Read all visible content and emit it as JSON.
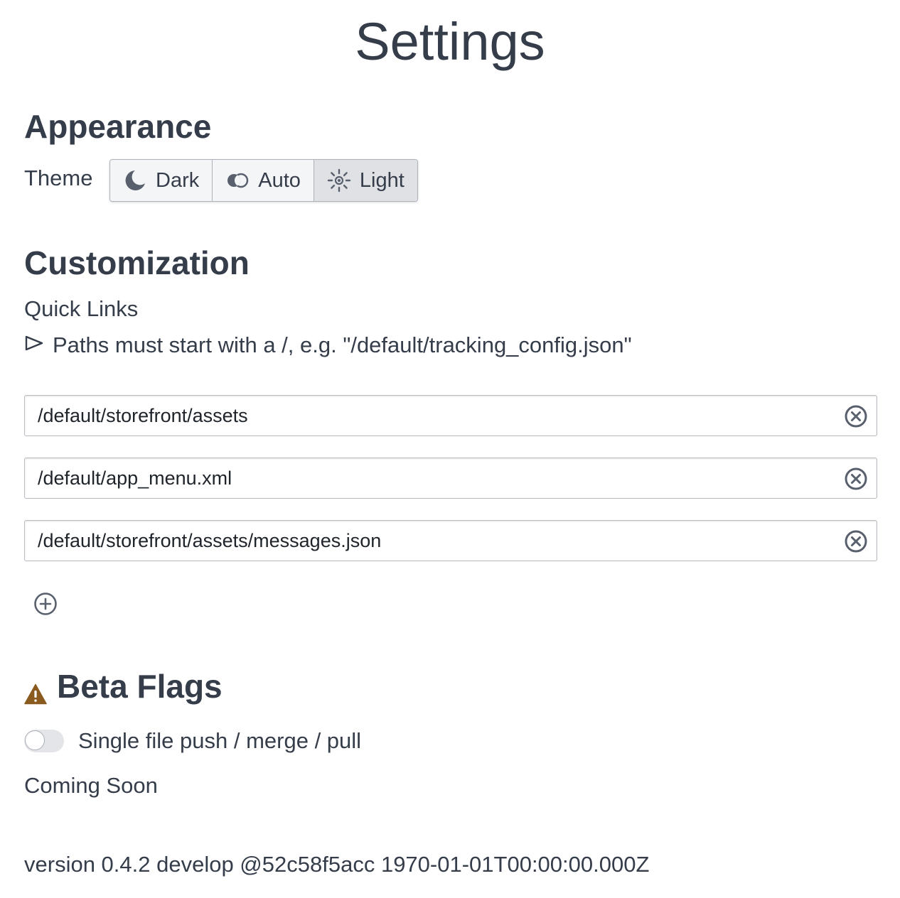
{
  "page": {
    "title": "Settings"
  },
  "appearance": {
    "heading": "Appearance",
    "theme_label": "Theme",
    "theme_options": [
      {
        "label": "Dark",
        "icon": "moon-icon"
      },
      {
        "label": "Auto",
        "icon": "auto-theme-icon"
      },
      {
        "label": "Light",
        "icon": "sun-icon"
      }
    ],
    "selected_theme": "Light"
  },
  "customization": {
    "heading": "Customization",
    "quick_links_label": "Quick Links",
    "hint_icon": "triangle-right-icon",
    "hint": "Paths must start with a /, e.g. \"/default/tracking_config.json\"",
    "links": [
      "/default/storefront/assets",
      "/default/app_menu.xml",
      "/default/storefront/assets/messages.json"
    ],
    "clear_icon": "circle-x-icon",
    "add_icon": "circle-plus-icon"
  },
  "beta": {
    "heading": "Beta Flags",
    "warning_icon": "warning-icon",
    "warning_color": "#8b5a1f",
    "toggle_label": "Single file push / merge / pull",
    "toggle_on": false,
    "coming_soon": "Coming Soon"
  },
  "footer": {
    "version": "version 0.4.2 develop @52c58f5acc 1970-01-01T00:00:00.000Z"
  },
  "colors": {
    "text": "#353d4a",
    "active_button": "#dfe1e5",
    "button_bg": "#f4f5f7"
  }
}
